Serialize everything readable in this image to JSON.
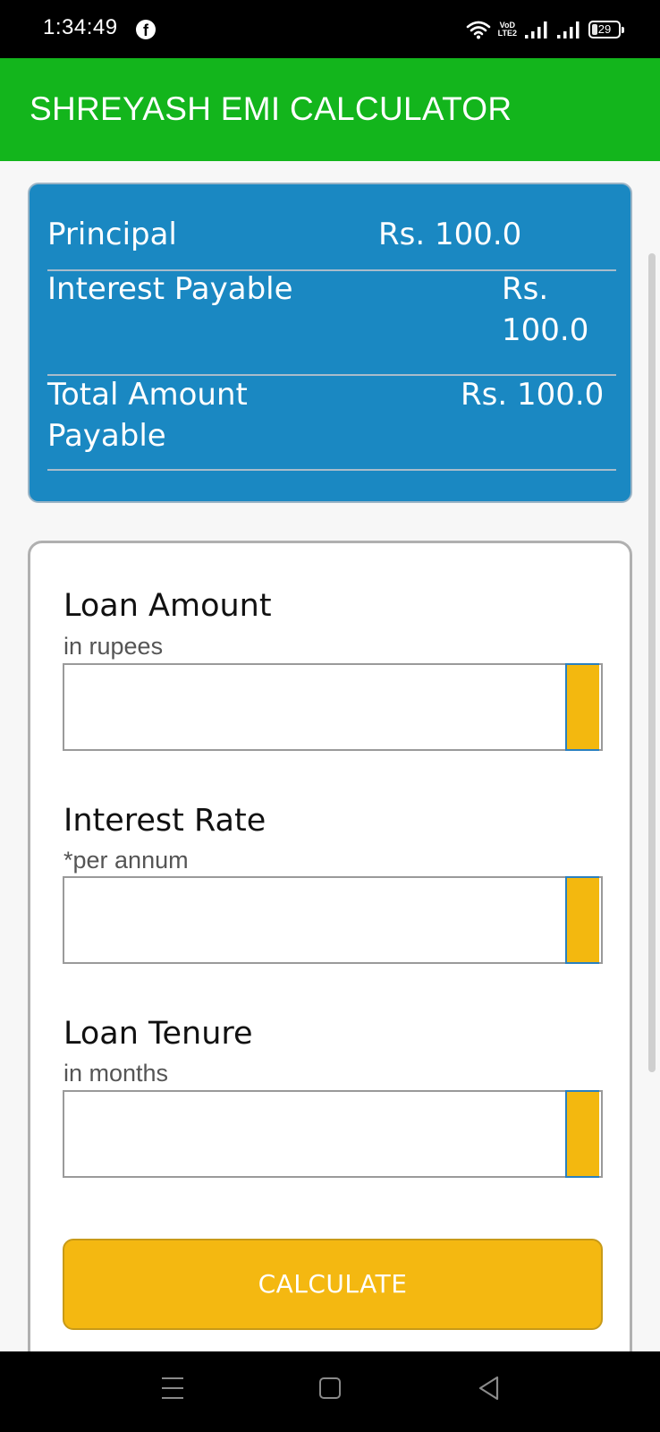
{
  "status_bar": {
    "time": "1:34:49",
    "volte_line1": "VoD",
    "volte_line2": "LTE2",
    "battery": "29",
    "icons": [
      "facebook-icon",
      "wifi-icon",
      "signal-icon",
      "signal-icon",
      "battery-icon"
    ]
  },
  "app_bar": {
    "title": "SHREYASH EMI CALCULATOR"
  },
  "summary": {
    "principal_label": "Principal",
    "principal_value": "Rs. 100.0",
    "interest_label": "Interest Payable",
    "interest_value_line1": "Rs.",
    "interest_value_line2": "100.0",
    "total_label_line1": "Total Amount",
    "total_label_line2": "Payable",
    "total_value": "Rs. 100.0"
  },
  "form": {
    "loan_amount_label": "Loan Amount",
    "loan_amount_hint": "in rupees",
    "loan_amount_value": "",
    "interest_rate_label": "Interest Rate",
    "interest_rate_hint": "*per annum",
    "interest_rate_value": "",
    "loan_tenure_label": "Loan Tenure",
    "loan_tenure_hint": "in months",
    "loan_tenure_value": "",
    "calculate_label": "CALCULATE"
  },
  "nav_bar": {
    "icons": [
      "menu-icon",
      "home-icon",
      "back-icon"
    ]
  },
  "colors": {
    "app_bar": "#13b51c",
    "summary_card": "#1a88c2",
    "accent": "#f4b811"
  }
}
